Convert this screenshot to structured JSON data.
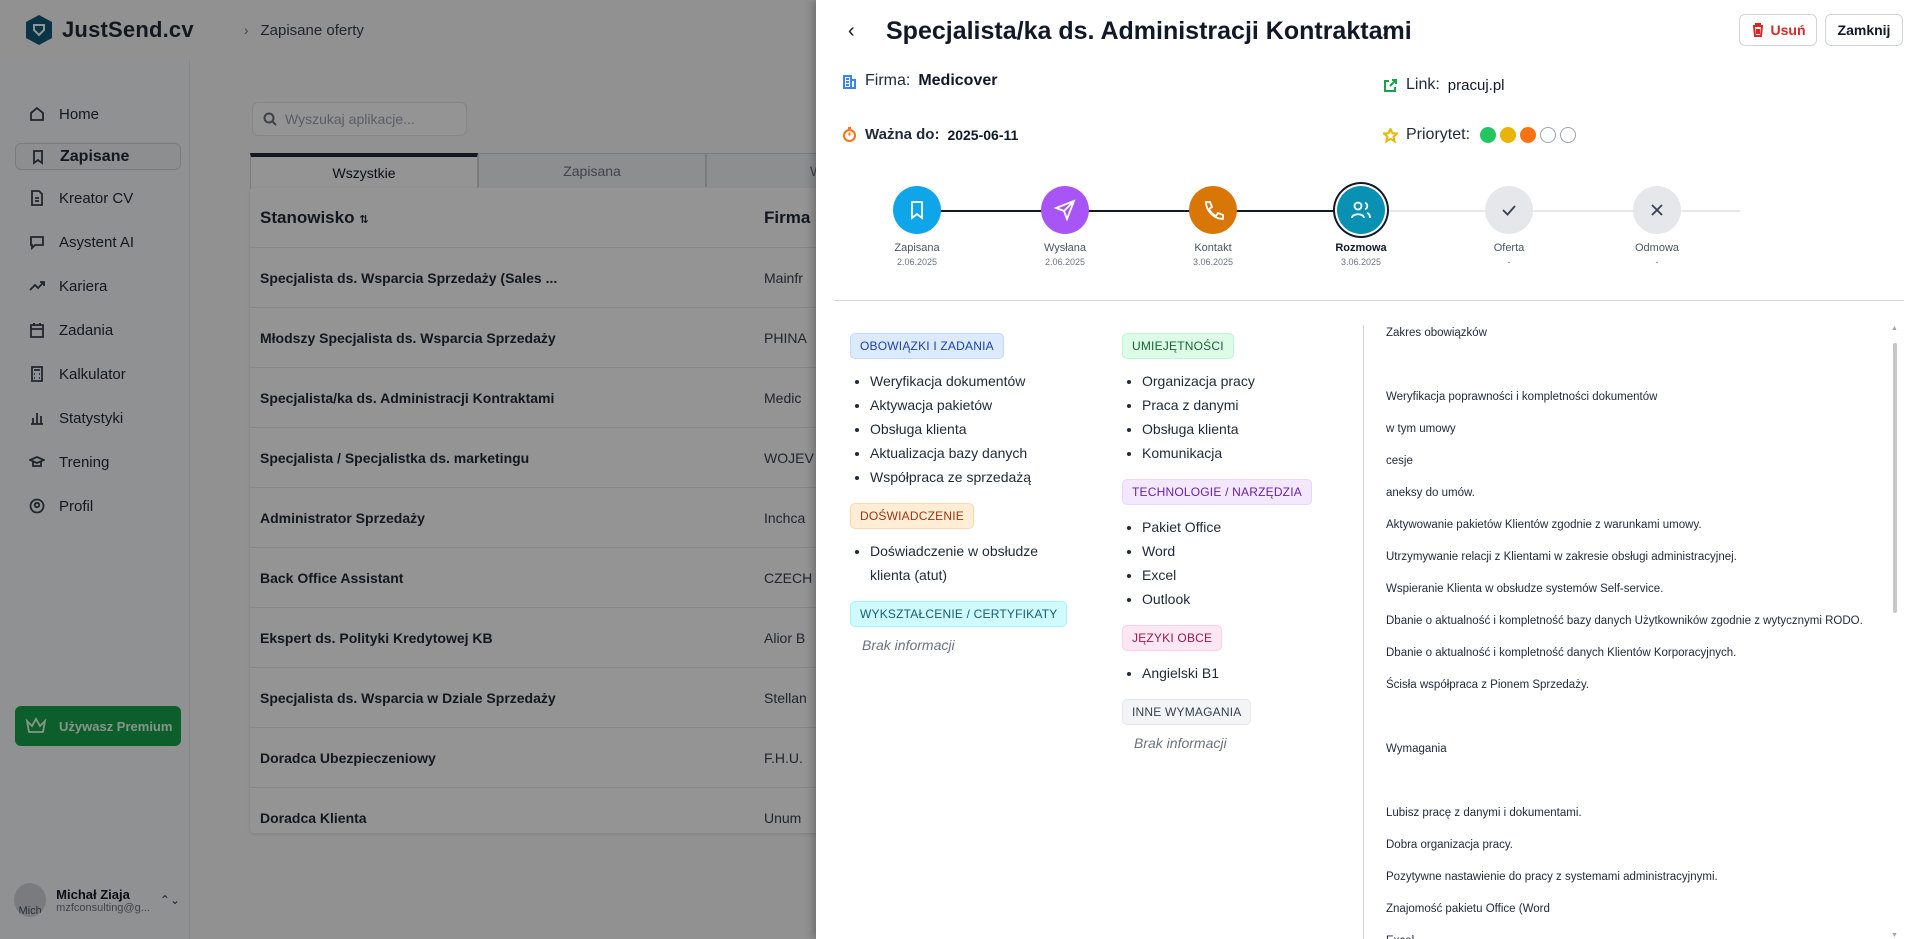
{
  "app": {
    "name": "JustSend.cv",
    "breadcrumb": "Zapisane oferty"
  },
  "sidebar": {
    "items": [
      {
        "label": "Home",
        "icon": "home-icon"
      },
      {
        "label": "Zapisane",
        "icon": "bookmark-icon",
        "active": true
      },
      {
        "label": "Kreator CV",
        "icon": "document-icon"
      },
      {
        "label": "Asystent AI",
        "icon": "chat-icon"
      },
      {
        "label": "Kariera",
        "icon": "trend-icon"
      },
      {
        "label": "Zadania",
        "icon": "calendar-icon"
      },
      {
        "label": "Kalkulator",
        "icon": "calculator-icon"
      },
      {
        "label": "Statystyki",
        "icon": "chart-icon"
      },
      {
        "label": "Trening",
        "icon": "graduation-icon"
      },
      {
        "label": "Profil",
        "icon": "user-icon"
      }
    ],
    "premium_label": "Używasz Premium",
    "user": {
      "name": "Michał Ziaja",
      "email": "mzfconsulting@g...",
      "avatar_alt": "Mich"
    }
  },
  "main": {
    "search_placeholder": "Wyszukaj aplikacje...",
    "tabs": [
      "Wszystkie",
      "Zapisana",
      "Wy"
    ],
    "columns": [
      "Stanowisko",
      "Firma"
    ],
    "rows": [
      {
        "title": "Specjalista ds. Wsparcia Sprzedaży (Sales ...",
        "company": "Mainfr"
      },
      {
        "title": "Młodszy Specjalista ds. Wsparcia Sprzedaży",
        "company": "PHINA"
      },
      {
        "title": "Specjalista/ka ds. Administracji Kontraktami",
        "company": "Medic"
      },
      {
        "title": "Specjalista / Specjalistka ds. marketingu",
        "company": "WOJEV"
      },
      {
        "title": "Administrator Sprzedaży",
        "company": "Inchca"
      },
      {
        "title": "Back Office Assistant",
        "company": "CZECH"
      },
      {
        "title": "Ekspert ds. Polityki Kredytowej KB",
        "company": "Alior B"
      },
      {
        "title": "Specjalista ds. Wsparcia w Dziale Sprzedaży",
        "company": "Stellan"
      },
      {
        "title": "Doradca Ubezpieczeniowy",
        "company": "F.H.U."
      },
      {
        "title": "Doradca Klienta",
        "company": "Unum"
      }
    ]
  },
  "drawer": {
    "title": "Specjalista/ka ds. Administracji Kontraktami",
    "delete_label": "Usuń",
    "close_label": "Zamknij",
    "company_label": "Firma:",
    "company": "Medicover",
    "link_label": "Link:",
    "link": "pracuj.pl",
    "valid_label": "Ważna do:",
    "valid_until": "2025-06-11",
    "priority_label": "Priorytet:",
    "priority_level": 3,
    "priority_colors": [
      "#22c55e",
      "#eab308",
      "#f97316"
    ],
    "steps": [
      {
        "label": "Zapisana",
        "date": "2.06.2025",
        "color": "#0ea5e9",
        "icon": "bookmark-icon"
      },
      {
        "label": "Wysłana",
        "date": "2.06.2025",
        "color": "#a855f7",
        "icon": "send-icon"
      },
      {
        "label": "Kontakt",
        "date": "3.06.2025",
        "color": "#d97706",
        "icon": "phone-icon"
      },
      {
        "label": "Rozmowa",
        "date": "3.06.2025",
        "color": "#0891b2",
        "icon": "users-icon",
        "current": true
      },
      {
        "label": "Oferta",
        "date": "-",
        "color": "#e5e7eb",
        "icon": "check-icon"
      },
      {
        "label": "Odmowa",
        "date": "-",
        "color": "#e5e7eb",
        "icon": "x-icon"
      }
    ],
    "sections": {
      "duties": {
        "title": "OBOWIĄZKI I ZADANIA",
        "items": [
          "Weryfikacja dokumentów",
          "Aktywacja pakietów",
          "Obsługa klienta",
          "Aktualizacja bazy danych",
          "Współpraca ze sprzedażą"
        ]
      },
      "experience": {
        "title": "DOŚWIADCZENIE",
        "items": [
          "Doświadczenie w obsłudze klienta (atut)"
        ]
      },
      "education": {
        "title": "WYKSZTAŁCENIE / CERTYFIKATY",
        "empty": "Brak informacji"
      },
      "skills": {
        "title": "UMIEJĘTNOŚCI",
        "items": [
          "Organizacja pracy",
          "Praca z danymi",
          "Obsługa klienta",
          "Komunikacja"
        ]
      },
      "tech": {
        "title": "TECHNOLOGIE / NARZĘDZIA",
        "items": [
          "Pakiet Office",
          "Word",
          "Excel",
          "Outlook"
        ]
      },
      "languages": {
        "title": "JĘZYKI OBCE",
        "items": [
          "Angielski B1"
        ]
      },
      "other": {
        "title": "INNE WYMAGANIA",
        "empty": "Brak informacji"
      }
    },
    "description": [
      "Zakres obowiązków",
      "",
      "Weryfikacja poprawności i kompletności dokumentów",
      "w tym umowy",
      "cesje",
      "aneksy do umów.",
      "Aktywowanie pakietów Klientów zgodnie z warunkami umowy.",
      "Utrzymywanie relacji z Klientami w zakresie obsługi administracyjnej.",
      "Wspieranie Klienta w obsłudze systemów Self-service.",
      "Dbanie o aktualność i kompletność bazy danych Użytkowników zgodnie z wytycznymi RODO.",
      "Dbanie o aktualność i kompletność danych Klientów Korporacyjnych.",
      "Ścisła współpraca z Pionem Sprzedaży.",
      "",
      "Wymagania",
      "",
      "Lubisz pracę z danymi i dokumentami.",
      "Dobra organizacja pracy.",
      "Pozytywne nastawienie do pracy z systemami administracyjnymi.",
      "Znajomość pakietu Office (Word",
      "Excel"
    ]
  }
}
